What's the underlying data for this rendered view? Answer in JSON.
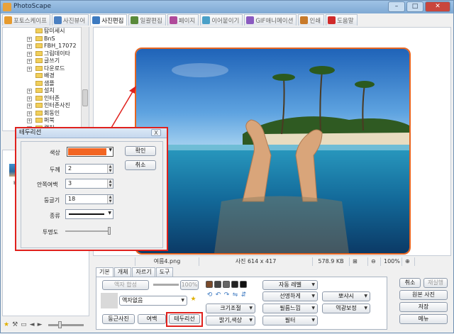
{
  "window": {
    "title": "PhotoScape"
  },
  "tabs": [
    {
      "label": "포토스케이프",
      "color": "#e79b2e"
    },
    {
      "label": "사진뷰어",
      "color": "#4a7fc1"
    },
    {
      "label": "사진편집",
      "color": "#3d7ac0"
    },
    {
      "label": "일괄편집",
      "color": "#5a8a3a"
    },
    {
      "label": "페이지",
      "color": "#b04a9a"
    },
    {
      "label": "이어붙이기",
      "color": "#4aa0c8"
    },
    {
      "label": "GIF애니메이션",
      "color": "#8a5ac0"
    },
    {
      "label": "인쇄",
      "color": "#c87a2a"
    },
    {
      "label": "도움말",
      "color": "#d02a2a"
    }
  ],
  "tree": {
    "items": [
      "탐미세시",
      "BnS",
      "FBH_17072",
      "그림데이타",
      "글쓰기",
      "다운로드",
      "배경",
      "샘플",
      "설치",
      "인터존",
      "인터존사진",
      "회동인",
      "퍼북",
      "캡처"
    ]
  },
  "thumbnail": {
    "label": "바"
  },
  "statusbar": {
    "filename": "여름4.png",
    "size_label": "사진 614 x 417",
    "filesize": "578.9 KB",
    "zoom": "100%"
  },
  "bottom_tabs": [
    "기본",
    "개체",
    "자르기",
    "도구"
  ],
  "panel": {
    "frame_button": "액자 합성",
    "percent": "100%",
    "frame_select": "액자없음",
    "round_photo": "둥근사진",
    "margin": "여백",
    "border": "테두리선",
    "auto_level": "자동 레벨",
    "sharpen": "선명하게",
    "backlight": "뽀샤시",
    "resize": "크기조절",
    "film": "필름느낌",
    "backlight_correct": "역광보정",
    "brightness": "밝기,색상",
    "filter": "필터"
  },
  "right_buttons": {
    "cancel": "취소",
    "save_as": "재실행",
    "original": "원본 사진",
    "save": "저장",
    "menu": "메뉴"
  },
  "dialog": {
    "title": "테두리선",
    "close": "X",
    "color_label": "색상",
    "color_value": "#f26522",
    "thickness_label": "두께",
    "thickness": "2",
    "inner_margin_label": "안쪽여백",
    "inner_margin": "3",
    "roundness_label": "둥글기",
    "roundness": "18",
    "type_label": "종류",
    "opacity_label": "투명도",
    "ok": "확인",
    "cancel": "취소"
  }
}
